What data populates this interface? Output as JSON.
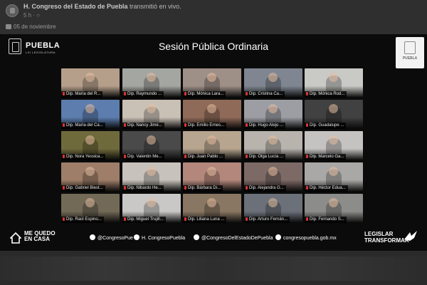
{
  "post": {
    "page_name": "H. Congreso del Estado de Puebla",
    "action": "transmitió en vivo.",
    "meta": "5 h · ○",
    "date": "05 de noviembre"
  },
  "video": {
    "logo_text": "PUEBLA",
    "logo_sub": "LXI LEGISLATURA",
    "title": "Sesión Pública Ordinaria",
    "badge_text": "PUEBLA"
  },
  "participants": [
    {
      "name": "Dip. María del R...",
      "bg": "#b59f8a"
    },
    {
      "name": "Dip. Raymundo ...",
      "bg": "#a4a6a2"
    },
    {
      "name": "Dip. Mónica Lara...",
      "bg": "#9e8f87"
    },
    {
      "name": "Dip. Cristina Ca...",
      "bg": "#7f8691"
    },
    {
      "name": "Dip. Mónica Rod...",
      "bg": "#c9c9c6"
    },
    {
      "name": "Dip. María del Ca...",
      "bg": "#5c7dae"
    },
    {
      "name": "Dip. Nancy Jimé...",
      "bg": "#c9c0b6"
    },
    {
      "name": "Dip. Emilio Ernes...",
      "bg": "#8f6a58"
    },
    {
      "name": "Dip. Hugo Alejo ...",
      "bg": "#9c9ea4"
    },
    {
      "name": "Dip. Guadalupe ...",
      "bg": "#414141"
    },
    {
      "name": "Dip. Nora Yessica...",
      "bg": "#6f6a3c"
    },
    {
      "name": "Dip. Valentin Me...",
      "bg": "#4a4a4a"
    },
    {
      "name": "Dip. Juan Pablo ...",
      "bg": "#b7a58f"
    },
    {
      "name": "Dip. Olga Lucía ...",
      "bg": "#b8b3ad"
    },
    {
      "name": "Dip. Marcelo Ga...",
      "bg": "#c5c3c1"
    },
    {
      "name": "Dip. Gabriel Biest...",
      "bg": "#9e7e68"
    },
    {
      "name": "Dip. Nibardo He...",
      "bg": "#c7c2bb"
    },
    {
      "name": "Dip. Bárbara Di...",
      "bg": "#b3877c"
    },
    {
      "name": "Dip. Alejandra G...",
      "bg": "#7d6a66"
    },
    {
      "name": "Dip. Héctor Edua...",
      "bg": "#a9a8a6"
    },
    {
      "name": "Dip. Raúl Espino...",
      "bg": "#726a57"
    },
    {
      "name": "Dip. Miguel Trujill...",
      "bg": "#c9c8c6"
    },
    {
      "name": "Dip. Liliana Luna ...",
      "bg": "#8a7763"
    },
    {
      "name": "Dip. Arturo Fernán...",
      "bg": "#6b7079"
    },
    {
      "name": "Dip. Fernando S...",
      "bg": "#8c8c8a"
    }
  ],
  "footer": {
    "campaign": "ME QUEDO EN CASA",
    "twitter": "@CongresoPue",
    "facebook": "H. CongresoPuebla",
    "instagram": "@CongresoDelEstadoDePuebla",
    "web": "congresopuebla.gob.mx",
    "slogan_line1": "LEGISLAR",
    "slogan_line2": "TRANSFORMAR"
  }
}
